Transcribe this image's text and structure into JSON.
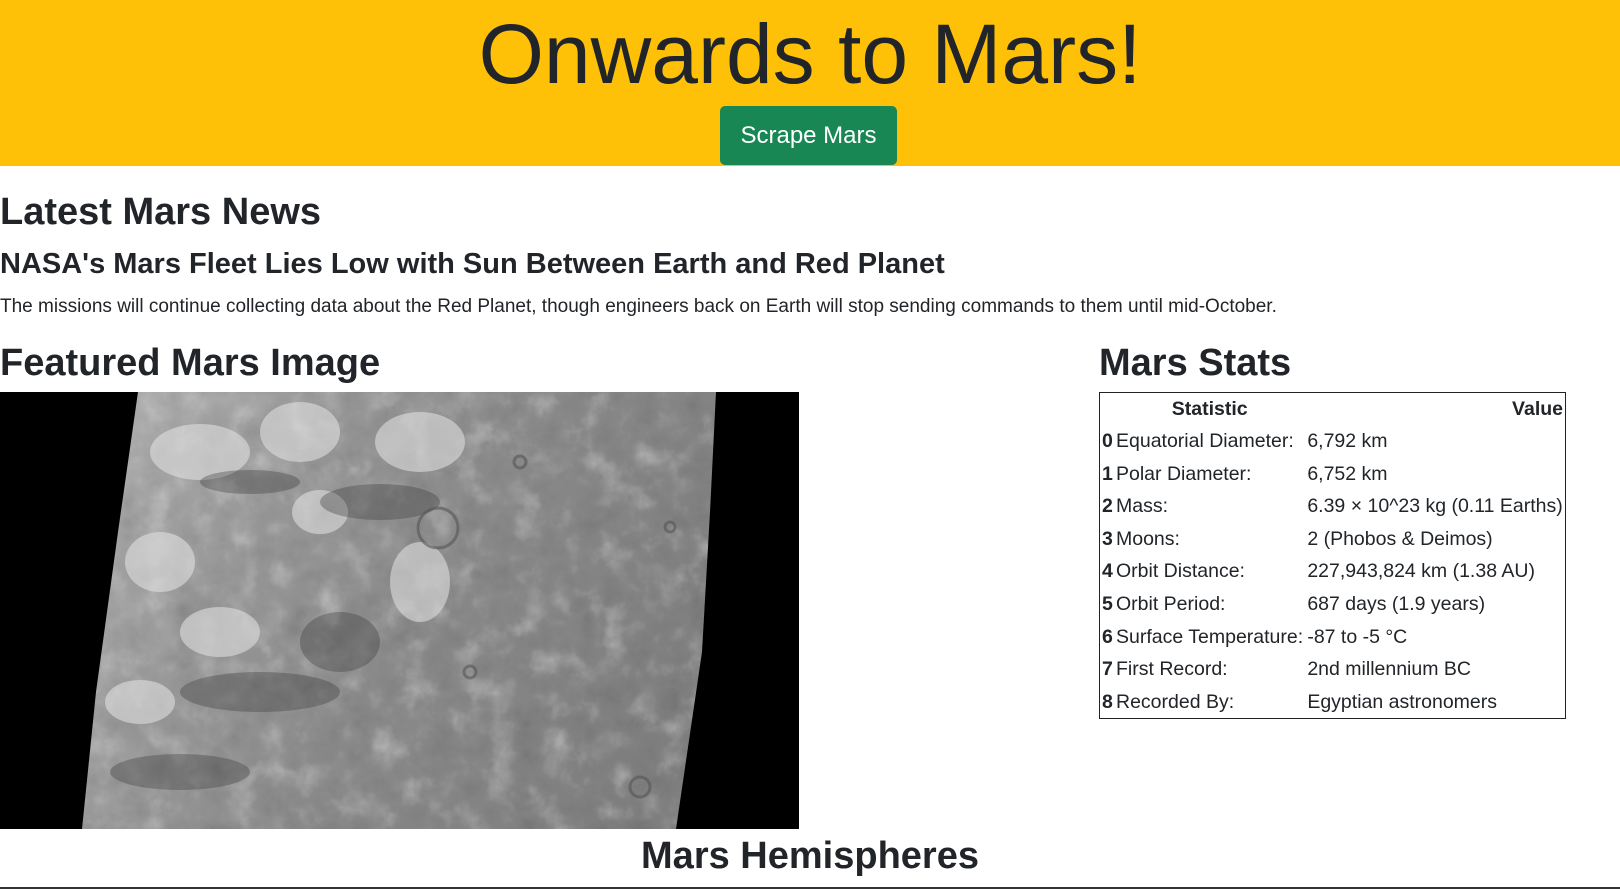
{
  "header": {
    "title": "Onwards to Mars!",
    "scrape_button": "Scrape Mars"
  },
  "news": {
    "heading": "Latest Mars News",
    "title": "NASA's Mars Fleet Lies Low with Sun Between Earth and Red Planet",
    "paragraph": "The missions will continue collecting data about the Red Planet, though engineers back on Earth will stop sending commands to them until mid-October."
  },
  "featured": {
    "heading": "Featured Mars Image"
  },
  "stats": {
    "heading": "Mars Stats",
    "columns": [
      "Statistic",
      "Value"
    ],
    "rows": [
      {
        "index": "0",
        "statistic": "Equatorial Diameter:",
        "value": "6,792 km"
      },
      {
        "index": "1",
        "statistic": "Polar Diameter:",
        "value": "6,752 km"
      },
      {
        "index": "2",
        "statistic": "Mass:",
        "value": "6.39 × 10^23 kg (0.11 Earths)"
      },
      {
        "index": "3",
        "statistic": "Moons:",
        "value": "2 (Phobos & Deimos)"
      },
      {
        "index": "4",
        "statistic": "Orbit Distance:",
        "value": "227,943,824 km (1.38 AU)"
      },
      {
        "index": "5",
        "statistic": "Orbit Period:",
        "value": "687 days (1.9 years)"
      },
      {
        "index": "6",
        "statistic": "Surface Temperature:",
        "value": "-87 to -5 °C"
      },
      {
        "index": "7",
        "statistic": "First Record:",
        "value": "2nd millennium BC"
      },
      {
        "index": "8",
        "statistic": "Recorded By:",
        "value": "Egyptian astronomers"
      }
    ]
  },
  "hemispheres": {
    "heading": "Mars Hemispheres"
  },
  "colors": {
    "jumbotron_bg": "#ffc107",
    "button_bg": "#198754",
    "text": "#212529"
  }
}
